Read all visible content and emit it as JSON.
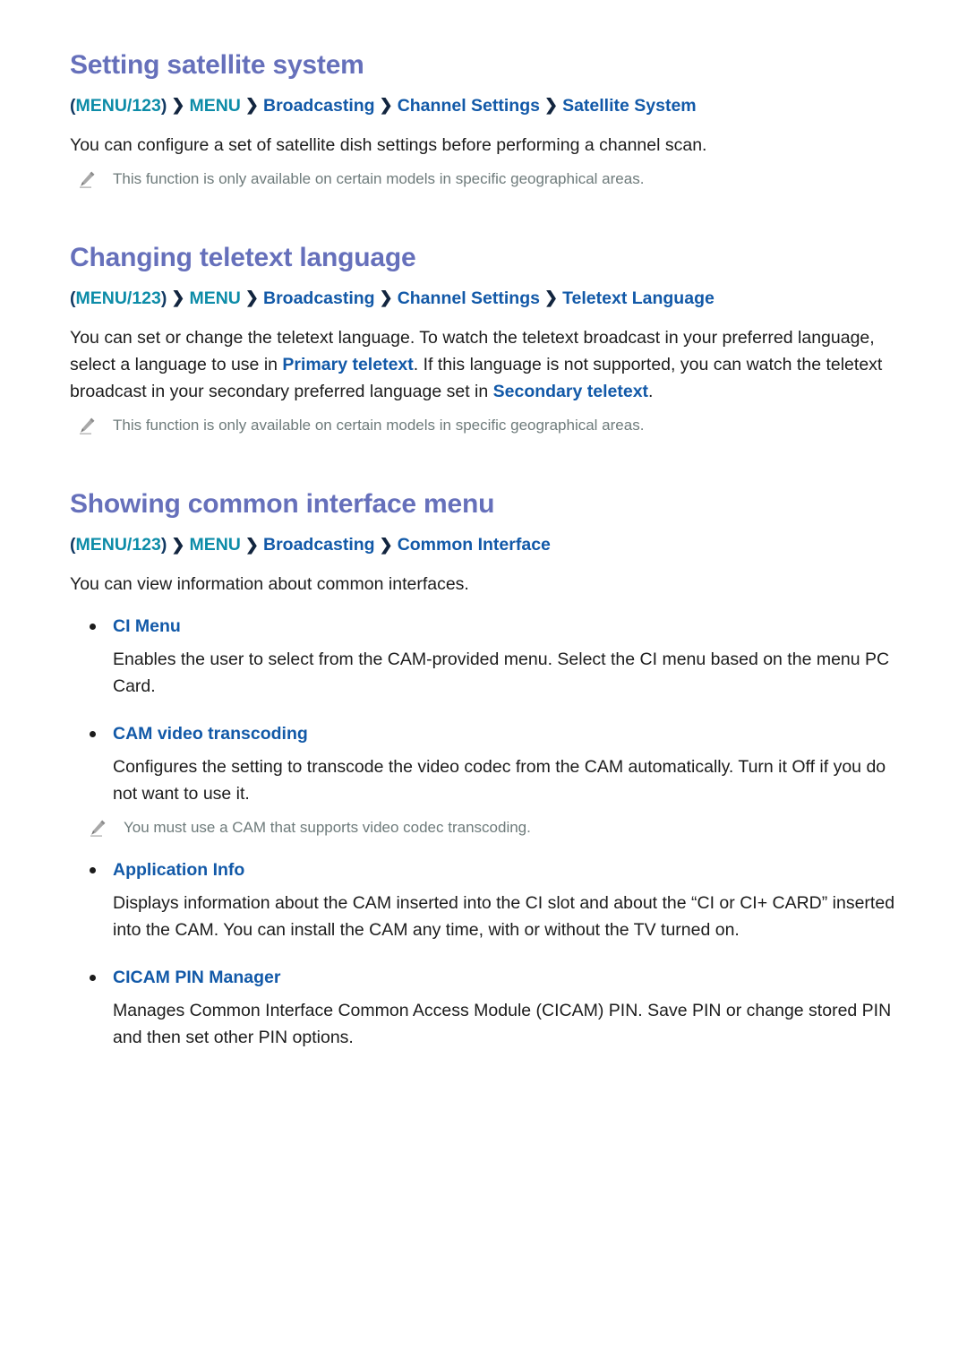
{
  "sections": [
    {
      "heading": "Setting satellite system",
      "breadcrumb": {
        "open_paren": "(",
        "first": "MENU/123",
        "close_paren": ")",
        "chevron": "›",
        "second": "MENU",
        "rest": [
          "Broadcasting",
          "Channel Settings",
          "Satellite System"
        ]
      },
      "paragraphs": [
        "You can configure a set of satellite dish settings before performing a channel scan."
      ],
      "note": "This function is only available on certain models in specific geographical areas."
    },
    {
      "heading": "Changing teletext language",
      "breadcrumb": {
        "open_paren": "(",
        "first": "MENU/123",
        "close_paren": ")",
        "chevron": "›",
        "second": "MENU",
        "rest": [
          "Broadcasting",
          "Channel Settings",
          "Teletext Language"
        ]
      },
      "paragraph_parts": {
        "p1": "You can set or change the teletext language. To watch the teletext broadcast in your preferred language, select a language to use in ",
        "link1": "Primary teletext",
        "p2": ". If this language is not supported, you can watch the teletext broadcast in your secondary preferred language set in ",
        "link2": "Secondary teletext",
        "p3": "."
      },
      "note": "This function is only available on certain models in specific geographical areas."
    },
    {
      "heading": "Showing common interface menu",
      "breadcrumb": {
        "open_paren": "(",
        "first": "MENU/123",
        "close_paren": ")",
        "chevron": "›",
        "second": "MENU",
        "rest": [
          "Broadcasting",
          "Common Interface"
        ]
      },
      "paragraphs": [
        "You can view information about common interfaces."
      ],
      "bullets": [
        {
          "label": "CI Menu",
          "desc": "Enables the user to select from the CAM-provided menu. Select the CI menu based on the menu PC Card."
        },
        {
          "label": "CAM video transcoding",
          "desc": "Configures the setting to transcode the video codec from the CAM automatically. Turn it Off if you do not want to use it.",
          "note": "You must use a CAM that supports video codec transcoding."
        },
        {
          "label": "Application Info",
          "desc": "Displays information about the CAM inserted into the CI slot and about the “CI or CI+ CARD” inserted into the CAM. You can install the CAM any time, with or without the TV turned on."
        },
        {
          "label": "CICAM PIN Manager",
          "desc": "Manages Common Interface Common Access Module (CICAM) PIN. Save PIN or change stored PIN and then set other PIN options."
        }
      ]
    }
  ],
  "icons": {
    "note_icon": "pencil-icon",
    "bullet_icon": "bullet-dot-icon",
    "chevron_icon": "chevron-right-icon"
  },
  "colors": {
    "heading": "#6670bb",
    "crumb_teal": "#0d8ca8",
    "crumb_blue": "#1259a8",
    "link": "#1259a8",
    "note_text": "#6e7b7b",
    "body_text": "#1c1c1c"
  }
}
